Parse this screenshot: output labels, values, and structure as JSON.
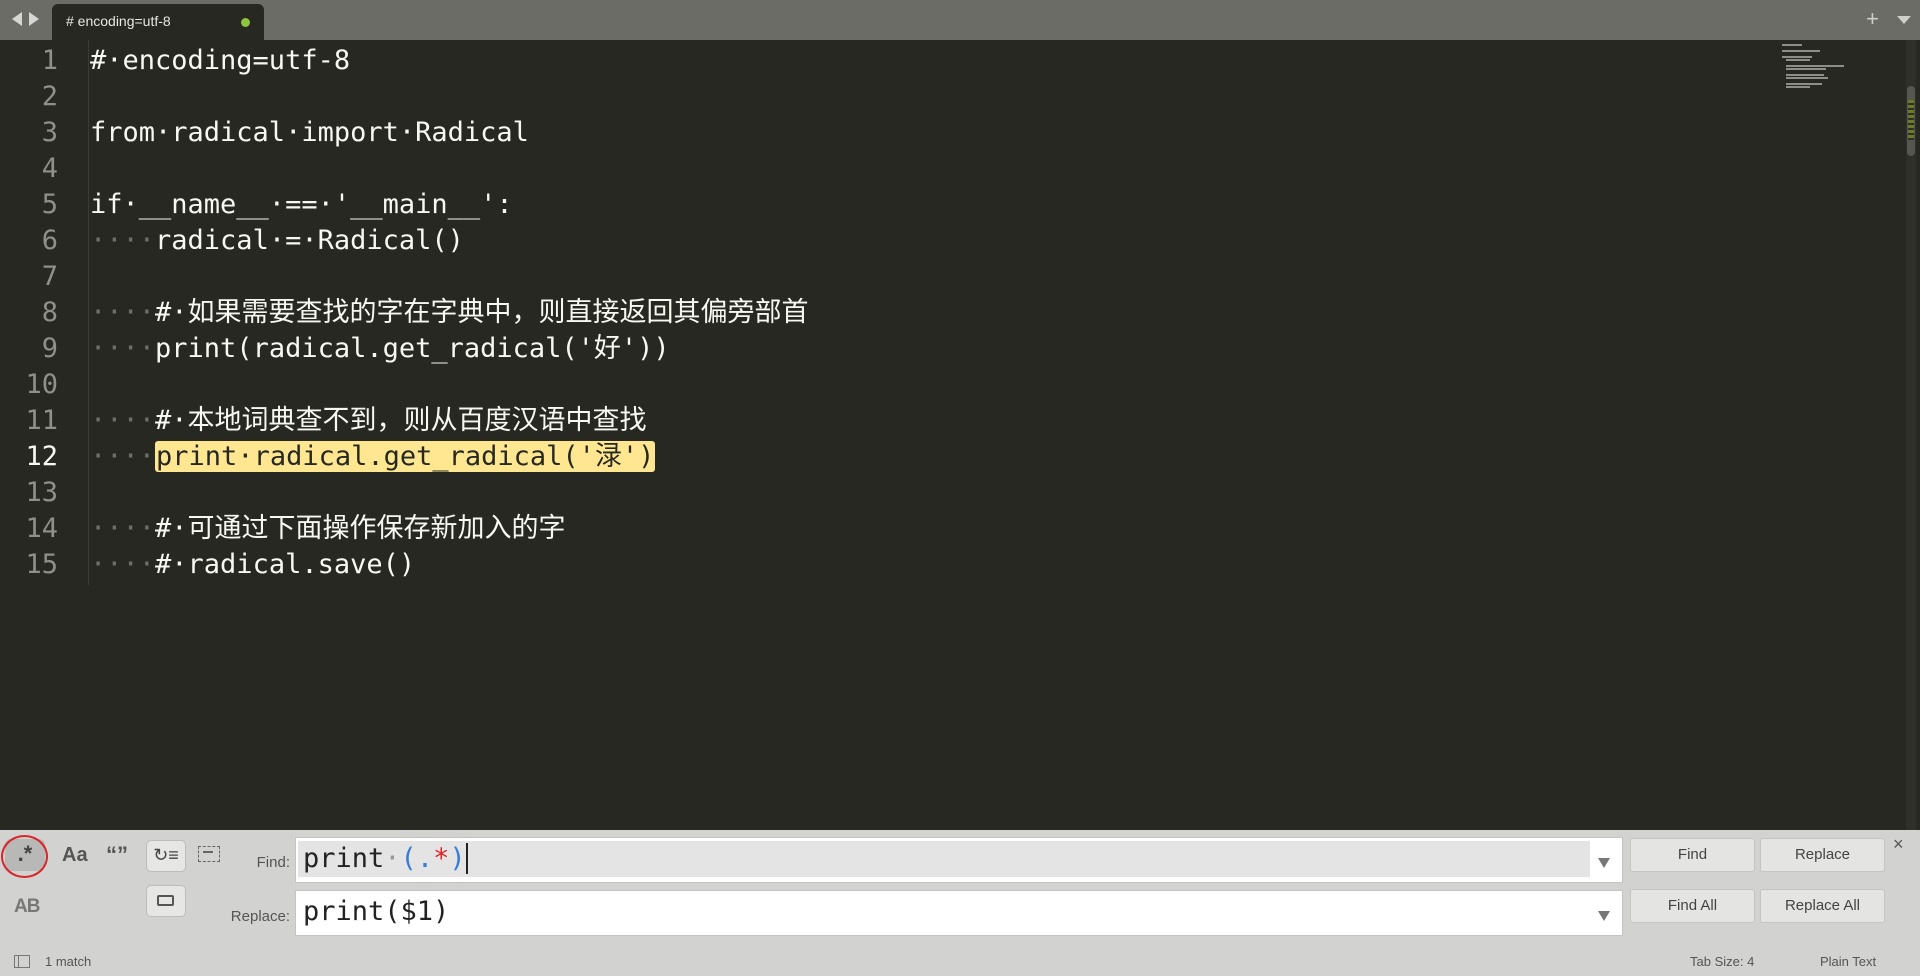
{
  "tab": {
    "title": "# encoding=utf-8",
    "modified": true
  },
  "editor": {
    "active_line": 12,
    "lines": [
      {
        "num": "1",
        "indent": "",
        "code": "#·encoding=utf-8"
      },
      {
        "num": "2",
        "indent": "",
        "code": ""
      },
      {
        "num": "3",
        "indent": "",
        "code": "from·radical·import·Radical"
      },
      {
        "num": "4",
        "indent": "",
        "code": ""
      },
      {
        "num": "5",
        "indent": "",
        "code": "if·__name__·==·'__main__':"
      },
      {
        "num": "6",
        "indent": "····",
        "code": "radical·=·Radical()"
      },
      {
        "num": "7",
        "indent": "",
        "code": ""
      },
      {
        "num": "8",
        "indent": "····",
        "code": "#·如果需要查找的字在字典中，则直接返回其偏旁部首"
      },
      {
        "num": "9",
        "indent": "····",
        "code": "print(radical.get_radical('好'))"
      },
      {
        "num": "10",
        "indent": "",
        "code": ""
      },
      {
        "num": "11",
        "indent": "····",
        "code": "#·本地词典查不到，则从百度汉语中查找"
      },
      {
        "num": "12",
        "indent": "····",
        "code": "print·radical.get_radical('渌')"
      },
      {
        "num": "13",
        "indent": "",
        "code": ""
      },
      {
        "num": "14",
        "indent": "····",
        "code": "#·可通过下面操作保存新加入的字"
      },
      {
        "num": "15",
        "indent": "····",
        "code": "#·radical.save()"
      }
    ]
  },
  "find_panel": {
    "options": {
      "regex": ".*",
      "case": "Aa",
      "whole_word": "“”",
      "wrap": "↻≡",
      "preserve_case": "AB"
    },
    "find_label": "Find:",
    "find_value": "print·(.*)",
    "find_parts": [
      "print",
      "·",
      "(",
      ".",
      "*",
      ")"
    ],
    "replace_label": "Replace:",
    "replace_value": "print($1)",
    "buttons": {
      "find": "Find",
      "replace": "Replace",
      "find_all": "Find All",
      "replace_all": "Replace All"
    },
    "close": "×"
  },
  "status": {
    "match": "1 match",
    "tab_size": "Tab Size: 4",
    "syntax": "Plain Text"
  },
  "colors": {
    "editor_bg": "#272822",
    "highlight": "#ffe792",
    "regex_circle": "#d8262a",
    "panel_bg": "#d2d2d0"
  }
}
